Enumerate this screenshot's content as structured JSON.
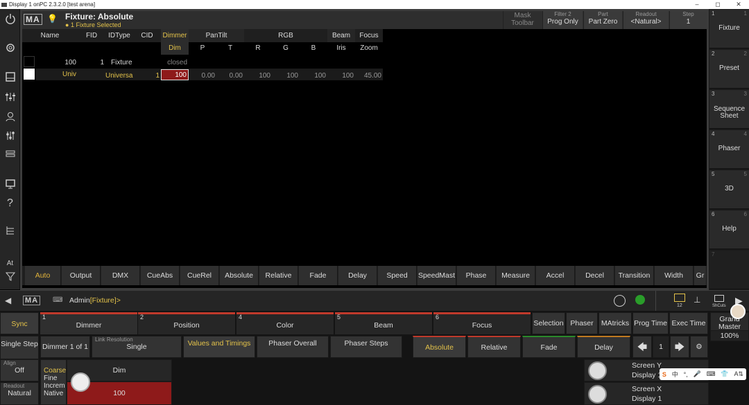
{
  "window": {
    "title": "Display 1 onPC 2.3.2.0 [test arena]",
    "controls": [
      "–",
      "◻",
      "✕"
    ]
  },
  "logo": "MA",
  "header": {
    "title": "Fixture: Absolute",
    "subtitle": "1 Fixture Selected",
    "buttons": [
      {
        "small": "Mask",
        "value": "Toolbar"
      },
      {
        "small": "Filter 2",
        "value": "Prog Only"
      },
      {
        "small": "Part",
        "value": "Part Zero"
      },
      {
        "small": "Readout",
        "value": "<Natural>"
      },
      {
        "small": "Step",
        "value": "1"
      }
    ]
  },
  "sheet": {
    "headers": [
      "Name",
      "FID",
      "IDType",
      "CID",
      "Dimmer",
      "PanTilt",
      "RGB",
      "Beam",
      "Focus"
    ],
    "sub": [
      "Dim",
      "P",
      "T",
      "R",
      "G",
      "B",
      "Iris",
      "Zoom"
    ],
    "row1": {
      "name": "100",
      "fid": "1",
      "idtype": "Fixture",
      "dim": "closed"
    },
    "row2": {
      "name": "Univ",
      "idtype": "Universa",
      "cid": "1",
      "dim": "100",
      "p": "0.00",
      "t": "0.00",
      "r": "100",
      "g": "100",
      "b": "100",
      "iris": "100",
      "zoom": "45.00"
    }
  },
  "features": [
    "Auto",
    "Output",
    "DMX",
    "CueAbs",
    "CueRel",
    "Absolute",
    "Relative",
    "Fade",
    "Delay",
    "Speed",
    "SpeedMast",
    "Phase",
    "Measure",
    "Accel",
    "Decel",
    "Transition",
    "Width",
    "Gr"
  ],
  "right": [
    {
      "n": "1",
      "label": "Fixture"
    },
    {
      "n": "2",
      "label": "Preset"
    },
    {
      "n": "3",
      "label": "Sequence Sheet"
    },
    {
      "n": "4",
      "label": "Phaser"
    },
    {
      "n": "5",
      "label": "3D"
    },
    {
      "n": "6",
      "label": "Help"
    },
    {
      "n": "7",
      "label": ""
    }
  ],
  "left": {
    "at": "At"
  },
  "cmd": {
    "prompt": "Admin",
    "object": "[Fixture]>",
    "mail_count": "12",
    "shortcuts": "ShCuts"
  },
  "enc": {
    "sync": "Sync",
    "single_step": "Single Step",
    "dimmer_of": "Dimmer 1 of 1",
    "link_small": "Link Resolution",
    "link_value": "Single",
    "values_timings": "Values and Timings",
    "phaser_overall": "Phaser Overall",
    "phaser_steps": "Phaser Steps",
    "absolute": "Absolute",
    "relative": "Relative",
    "fade": "Fade",
    "delay": "Delay",
    "page": "1",
    "align_small": "Align",
    "align_value": "Off",
    "readout_small": "Readout",
    "readout_value": "Natural",
    "res": [
      "Coarse",
      "Fine",
      "Increm",
      "Native"
    ],
    "dim_label": "Dim",
    "dim_value": "100",
    "grand": "Grand Master",
    "grand_value": "100%",
    "screen_y": "Screen Y",
    "screen_x": "Screen X",
    "display": "Display 1"
  },
  "tabs": [
    {
      "n": "1",
      "label": "Dimmer"
    },
    {
      "n": "2",
      "label": "Position"
    },
    {
      "n": "4",
      "label": "Color"
    },
    {
      "n": "5",
      "label": "Beam"
    },
    {
      "n": "6",
      "label": "Focus"
    }
  ],
  "tools": [
    "Selection",
    "Phaser",
    "MAtricks",
    "Prog Time",
    "Exec Time"
  ],
  "ime": [
    "S",
    "中",
    "°,",
    "🎤",
    "⌨",
    "👕",
    "A⇅"
  ]
}
